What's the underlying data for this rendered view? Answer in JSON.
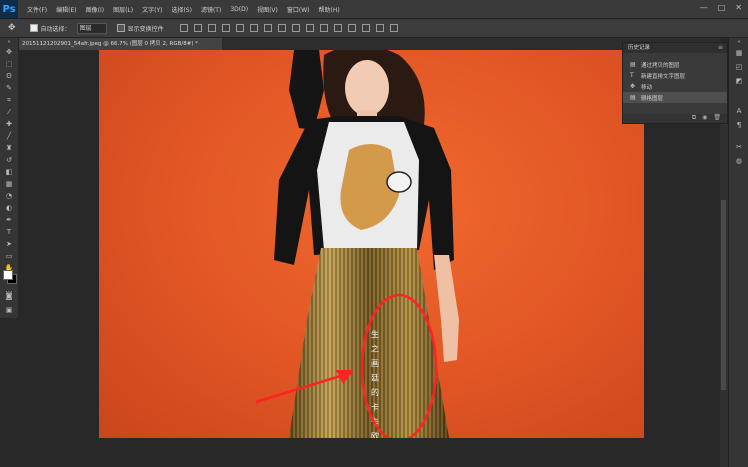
{
  "app": {
    "logo": "Ps",
    "menu": [
      "文件(F)",
      "编辑(E)",
      "图像(I)",
      "图层(L)",
      "文字(Y)",
      "选择(S)",
      "滤镜(T)",
      "3D(D)",
      "视图(V)",
      "窗口(W)",
      "帮助(H)"
    ],
    "window_controls": [
      "—",
      "□",
      "✕"
    ]
  },
  "options": {
    "move_icon": "✥",
    "auto_select_label": "自动选择：",
    "auto_select_value": "图层",
    "show_transform_label": "显示变换控件"
  },
  "document": {
    "tab_title": "20151121202901_54afr.jpeg @ 66.7% (图层 0 拷贝 2, RGB/8#) *"
  },
  "history": {
    "title": "历史记录",
    "items": [
      {
        "label": "通过拷贝的图层",
        "icon": "layer-icon",
        "selected": false
      },
      {
        "label": "新建直排文字图层",
        "icon": "type-icon",
        "selected": false
      },
      {
        "label": "移动",
        "icon": "move-icon",
        "selected": false
      },
      {
        "label": "删格图层",
        "icon": "layer-icon",
        "selected": true
      }
    ]
  },
  "annotation": {
    "watermark_text": "生 之 画 廷 的 卡 卡   欧 嘉 丽",
    "callout_color": "#ff2020"
  },
  "colors": {
    "background_orange": "#e25826",
    "ui_dark": "#282828"
  }
}
